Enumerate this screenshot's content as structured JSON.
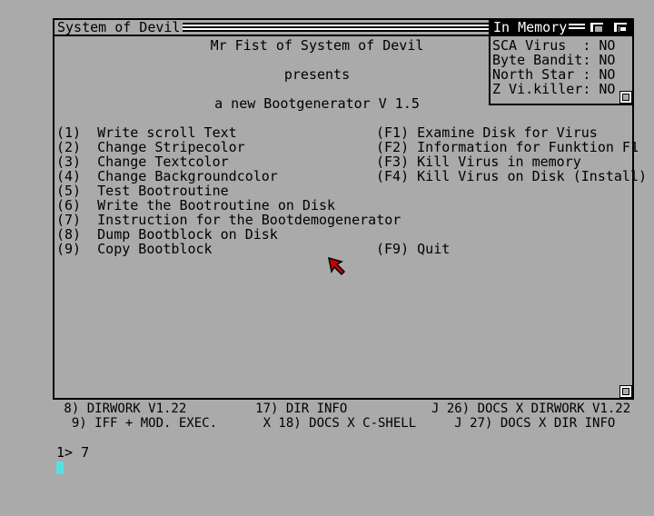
{
  "window": {
    "title": "System of Devil",
    "header_lines": [
      "Mr Fist of System of Devil",
      "presents",
      "a new Bootgenerator V 1.5"
    ],
    "menu_left": [
      {
        "key": "(1)",
        "label": "Write scroll Text"
      },
      {
        "key": "(2)",
        "label": "Change Stripecolor"
      },
      {
        "key": "(3)",
        "label": "Change Textcolor"
      },
      {
        "key": "(4)",
        "label": "Change Backgroundcolor"
      },
      {
        "key": "(5)",
        "label": "Test Bootroutine"
      },
      {
        "key": "(6)",
        "label": "Write the Bootroutine on Disk"
      },
      {
        "key": "(7)",
        "label": "Instruction for the Bootdemogenerator"
      },
      {
        "key": "(8)",
        "label": "Dump Bootblock on Disk"
      },
      {
        "key": "(9)",
        "label": "Copy Bootblock"
      }
    ],
    "menu_right": [
      {
        "key": "(F1)",
        "label": "Examine Disk for Virus"
      },
      {
        "key": "(F2)",
        "label": "Information for Funktion F1"
      },
      {
        "key": "(F3)",
        "label": "Kill Virus in memory"
      },
      {
        "key": "(F4)",
        "label": "Kill Virus on Disk (Install)"
      }
    ],
    "quit": {
      "key": "(F9)",
      "label": "Quit"
    }
  },
  "memory": {
    "title": "In Memory",
    "rows": [
      {
        "name": "SCA Virus  ",
        "value": ": NO"
      },
      {
        "name": "Byte Bandit",
        "value": ": NO"
      },
      {
        "name": "North Star ",
        "value": ": NO"
      },
      {
        "name": "Z Vi.killer",
        "value": ": NO"
      }
    ]
  },
  "shell": {
    "lines": [
      " 8) DIRWORK V1.22         17) DIR INFO           J 26) DOCS X DIRWORK V1.22",
      "  9) IFF + MOD. EXEC.      X 18) DOCS X C-SHELL     J 27) DOCS X DIR INFO"
    ],
    "prompt": "1> 7"
  },
  "colors": {
    "background": "#aaaaaa",
    "text": "#000000",
    "pointer": "#cc0000",
    "cursor": "#55e0e0"
  },
  "icons": [
    "close-gadget-icon",
    "depth-gadget-icon",
    "window-sizer-icon",
    "mouse-pointer-icon"
  ]
}
